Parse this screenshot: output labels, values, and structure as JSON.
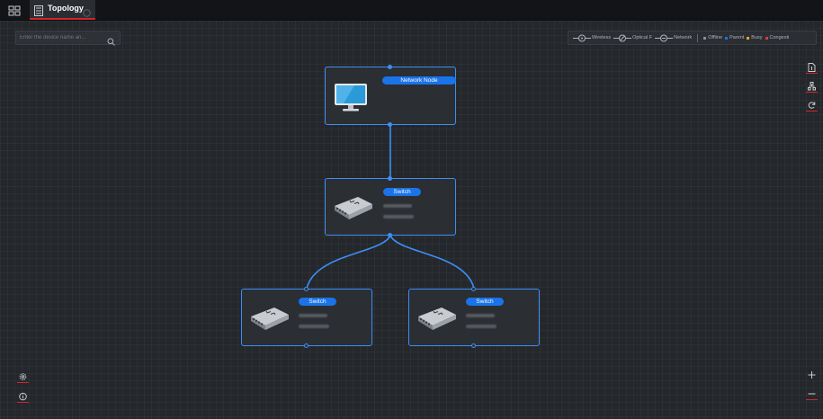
{
  "header": {
    "apps_icon": "grid-icon",
    "tab": {
      "label": "Topology",
      "icon": "topology-icon",
      "close_icon": "close-icon"
    }
  },
  "search": {
    "placeholder": "Enter the device name an...",
    "value": "",
    "icon": "search-icon"
  },
  "legend": {
    "links": [
      {
        "label": "Wireless",
        "icon": "wireless-link-icon"
      },
      {
        "label": "Optical F",
        "icon": "optical-fiber-link-icon"
      },
      {
        "label": "Network",
        "icon": "network-link-icon"
      }
    ],
    "statuses": [
      {
        "label": "Offline",
        "color": "#8a8f96"
      },
      {
        "label": "Parent",
        "color": "#1a73e8"
      },
      {
        "label": "Busy",
        "color": "#f5a623"
      },
      {
        "label": "Congesti",
        "color": "#e2383f"
      }
    ]
  },
  "tools": {
    "right": [
      {
        "name": "export-icon"
      },
      {
        "name": "hierarchy-icon"
      },
      {
        "name": "refresh-icon"
      }
    ],
    "left_bottom": [
      {
        "name": "settings-icon"
      },
      {
        "name": "info-icon"
      }
    ],
    "zoom": [
      {
        "name": "zoom-in-icon",
        "glyph": "+"
      },
      {
        "name": "zoom-out-icon",
        "glyph": "−"
      }
    ]
  },
  "nodes": [
    {
      "id": "root",
      "label": "Network Node",
      "device": "monitor-icon"
    },
    {
      "id": "sw1",
      "label": "Switch",
      "device": "switch-icon"
    },
    {
      "id": "sw2",
      "label": "Switch",
      "device": "switch-icon"
    },
    {
      "id": "sw3",
      "label": "Switch",
      "device": "switch-icon"
    }
  ],
  "colors": {
    "accent": "#1a73e8",
    "link": "#3c8ff6",
    "underline": "#d0262c",
    "background": "#24272b"
  }
}
